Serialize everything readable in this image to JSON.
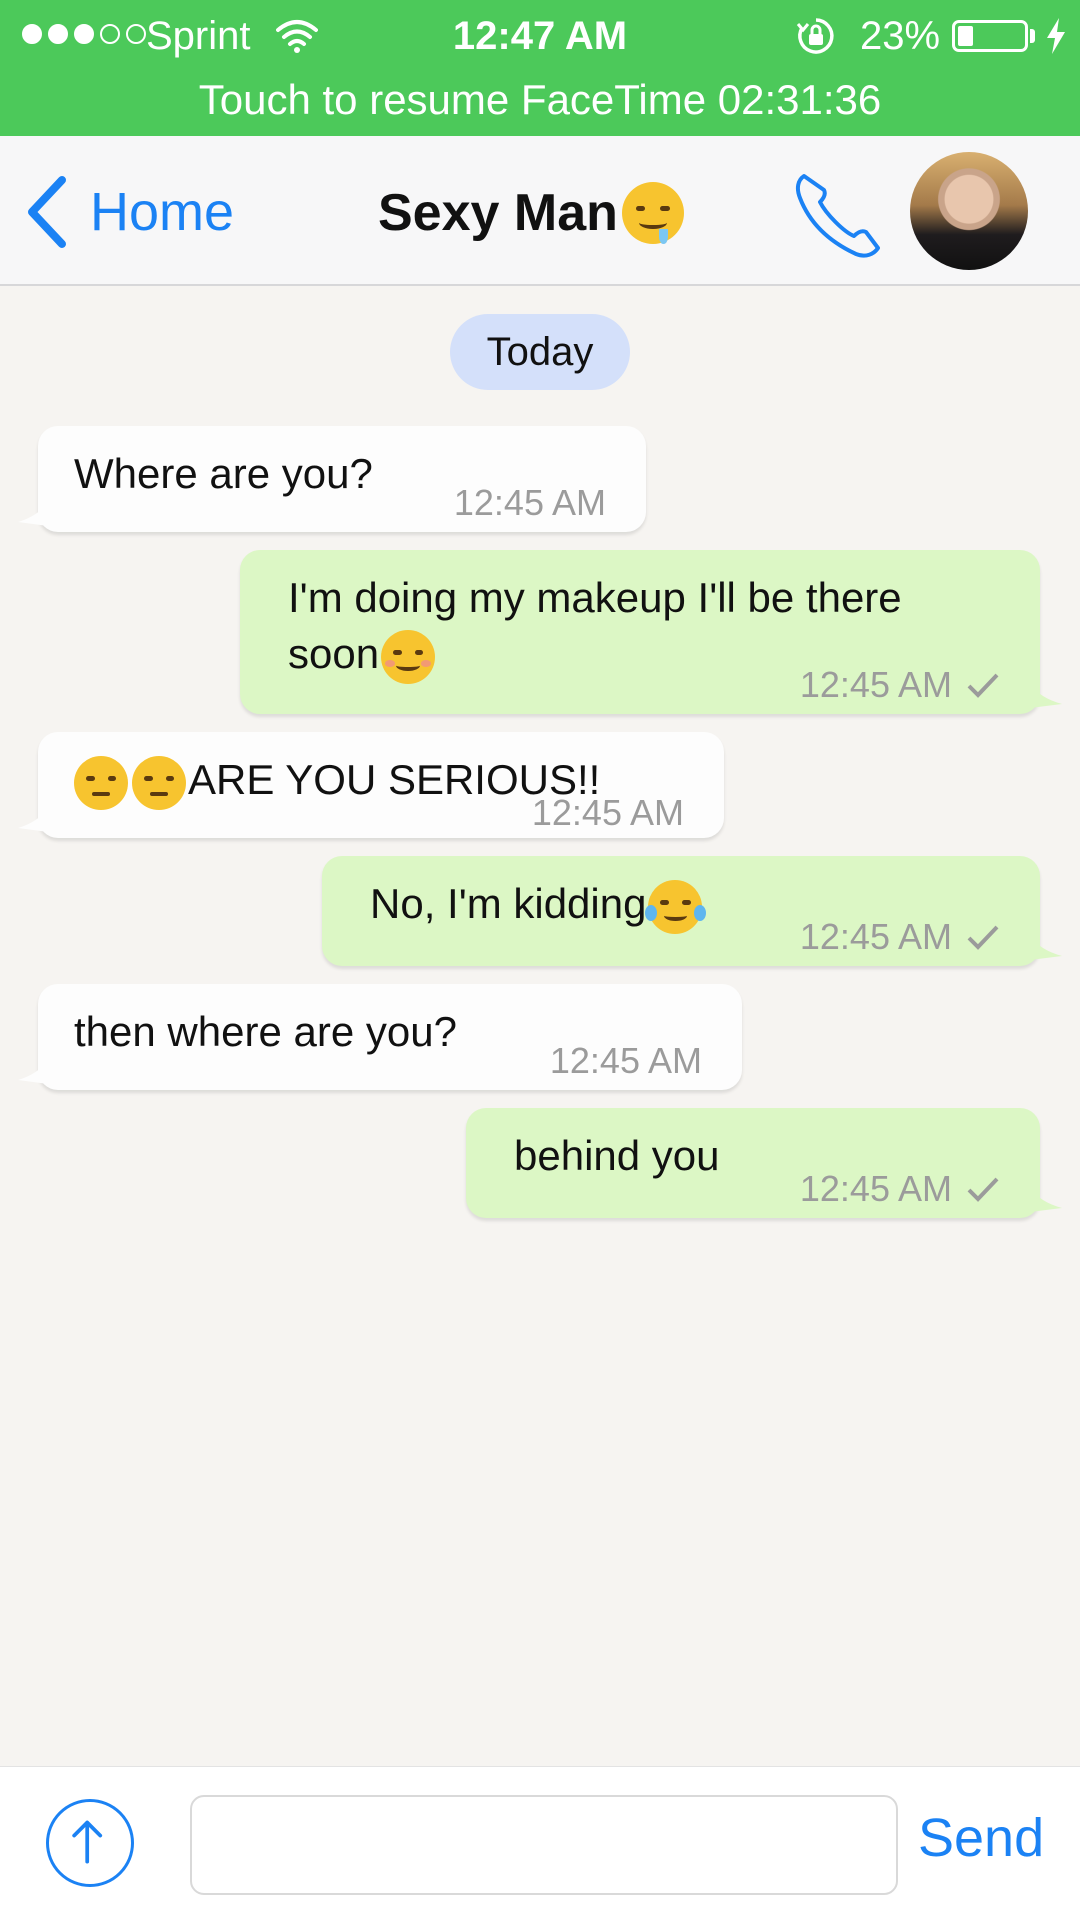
{
  "status_bar": {
    "carrier": "Sprint",
    "signal_bars_filled": 3,
    "signal_bars_total": 5,
    "time": "12:47 AM",
    "battery_percent": "23%",
    "battery_level": 0.23,
    "charging": true,
    "banner": "Touch to resume FaceTime 02:31:36",
    "banner_color": "#4cc95a"
  },
  "nav": {
    "back_label": "Home",
    "title": "Sexy Man",
    "title_emoji": "drooling-face",
    "accent_color": "#1b82f4"
  },
  "chat": {
    "date_divider": "Today",
    "messages": [
      {
        "direction": "in",
        "text": "Where are you?",
        "time": "12:45 AM"
      },
      {
        "direction": "out",
        "text": "I'm doing my makeup I'll be there soon",
        "emoji_after": "smiling-face",
        "time": "12:45 AM",
        "status": "sent"
      },
      {
        "direction": "in",
        "emoji_before": [
          "unamused-face",
          "unamused-face"
        ],
        "text": "ARE YOU SERIOUS!!",
        "time": "12:45 AM"
      },
      {
        "direction": "out",
        "text": "No, I'm kidding",
        "emoji_after": "tears-of-joy-face",
        "time": "12:45 AM",
        "status": "sent"
      },
      {
        "direction": "in",
        "text": "then where are you?",
        "time": "12:45 AM"
      },
      {
        "direction": "out",
        "text": "behind you",
        "time": "12:45 AM",
        "status": "sent"
      }
    ]
  },
  "input": {
    "placeholder": "",
    "send_label": "Send"
  }
}
